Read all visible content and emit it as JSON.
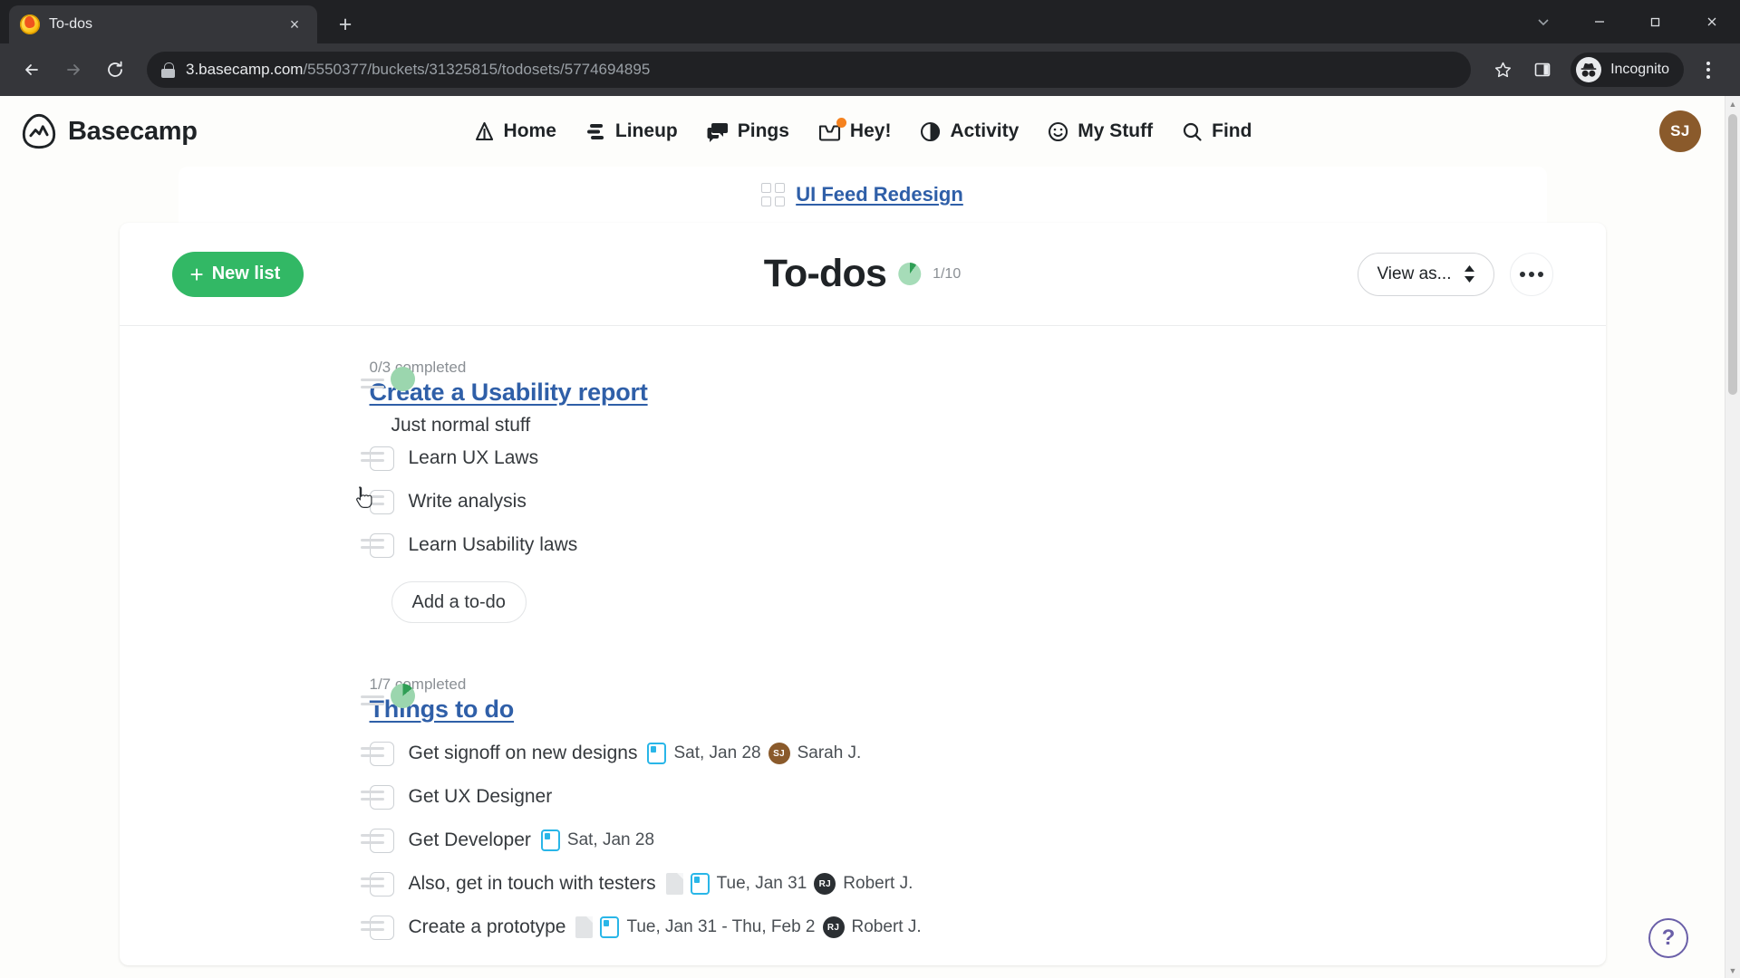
{
  "browser": {
    "tab_title": "To-dos",
    "favicon": "basecamp-favicon",
    "close_tab": "×",
    "new_tab": "+",
    "window_controls": [
      "minimize-to-tray-chevron",
      "minimize",
      "maximize",
      "close"
    ],
    "back": "back-arrow",
    "forward": "forward-arrow",
    "reload": "reload-icon",
    "url_host": "3.basecamp.com",
    "url_path": "/5550377/buckets/31325815/todosets/5774694895",
    "bookmark": "star-icon",
    "side_panel": "side-panel-icon",
    "incognito_label": "Incognito",
    "menu": "kebab-menu-icon"
  },
  "bc_nav": {
    "brand": "Basecamp",
    "links": [
      {
        "label": "Home",
        "icon": "home-icon"
      },
      {
        "label": "Lineup",
        "icon": "lineup-icon"
      },
      {
        "label": "Pings",
        "icon": "pings-icon"
      },
      {
        "label": "Hey!",
        "icon": "hey-inbox-icon",
        "badge": true
      },
      {
        "label": "Activity",
        "icon": "activity-icon"
      },
      {
        "label": "My Stuff",
        "icon": "my-stuff-smiley-icon"
      },
      {
        "label": "Find",
        "icon": "search-icon"
      }
    ],
    "avatar_initials": "SJ",
    "avatar_color": "#8a5a2b"
  },
  "project": {
    "name": "UI Feed Redesign",
    "icon": "grid-squares-icon",
    "link_color": "#2f5fa8"
  },
  "header": {
    "new_list_label": "New list",
    "new_list_color": "#32b865",
    "title": "To-dos",
    "progress_label": "1/10",
    "progress_percent": 10,
    "view_as_label": "View as...",
    "more_label": "•••"
  },
  "lists": [
    {
      "completed_label": "0/3 completed",
      "title": "Create a Usability report",
      "description": "Just normal stuff",
      "progress_percent": 0,
      "add_todo_label": "Add a to-do",
      "todos": [
        {
          "text": "Learn UX Laws",
          "checked": false,
          "date": "",
          "assignee": "",
          "notes": false
        },
        {
          "text": "Write analysis",
          "checked": false,
          "date": "",
          "assignee": "",
          "notes": false
        },
        {
          "text": "Learn Usability laws",
          "checked": false,
          "date": "",
          "assignee": "",
          "notes": false
        }
      ]
    },
    {
      "completed_label": "1/7 completed",
      "title": "Things to do",
      "description": "",
      "progress_percent": 14,
      "add_todo_label": "",
      "todos": [
        {
          "text": "Get signoff on new designs",
          "checked": false,
          "date": "Sat, Jan 28",
          "assignee": "Sarah J.",
          "initials": "SJ",
          "avatar_color": "#8a5a2b",
          "notes": false
        },
        {
          "text": "Get UX Designer",
          "checked": false,
          "date": "",
          "assignee": "",
          "notes": false
        },
        {
          "text": "Get Developer",
          "checked": false,
          "date": "Sat, Jan 28",
          "assignee": "",
          "notes": false
        },
        {
          "text": "Also, get in touch with testers",
          "checked": false,
          "date": "Tue, Jan 31",
          "assignee": "Robert J.",
          "initials": "RJ",
          "avatar_color": "#2b2f33",
          "notes": true
        },
        {
          "text": "Create a prototype",
          "checked": false,
          "date": "Tue, Jan 31 - Thu, Feb 2",
          "assignee": "Robert J.",
          "initials": "RJ",
          "avatar_color": "#2b2f33",
          "notes": true
        }
      ]
    }
  ],
  "help": {
    "label": "?",
    "color": "#6a5fa8"
  }
}
